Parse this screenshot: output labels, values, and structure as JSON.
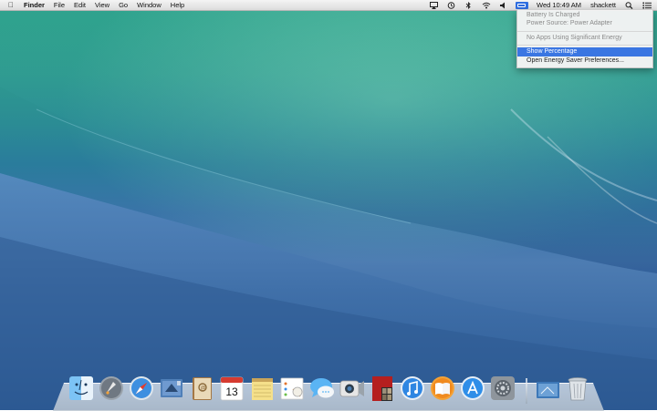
{
  "menubar": {
    "apple_icon": "apple-icon",
    "app_name": "Finder",
    "menus": [
      "File",
      "Edit",
      "View",
      "Go",
      "Window",
      "Help"
    ],
    "status_icons": [
      "airplay-icon",
      "time-machine-icon",
      "bluetooth-icon",
      "wifi-icon",
      "volume-icon",
      "battery-icon"
    ],
    "clock": "Wed 10:49 AM",
    "user": "shackett",
    "right_icons": [
      "spotlight-icon",
      "notification-center-icon"
    ]
  },
  "battery_menu": {
    "status_line1": "Battery Is Charged",
    "status_line2": "Power Source: Power Adapter",
    "apps_line": "No Apps Using Significant Energy",
    "show_percentage": "Show Percentage",
    "preferences": "Open Energy Saver Preferences..."
  },
  "dock": {
    "apps": [
      "Finder",
      "Launchpad",
      "Safari",
      "Mail",
      "Contacts",
      "Calendar",
      "Notes",
      "Reminders",
      "Messages",
      "FaceTime",
      "Photo Booth",
      "iTunes",
      "iBooks",
      "App Store",
      "System Preferences"
    ],
    "calendar_day": "13",
    "stacks": [
      "Downloads",
      "Trash"
    ]
  },
  "colors": {
    "highlight": "#3a76e2",
    "menubar": "#e6e6e6"
  }
}
